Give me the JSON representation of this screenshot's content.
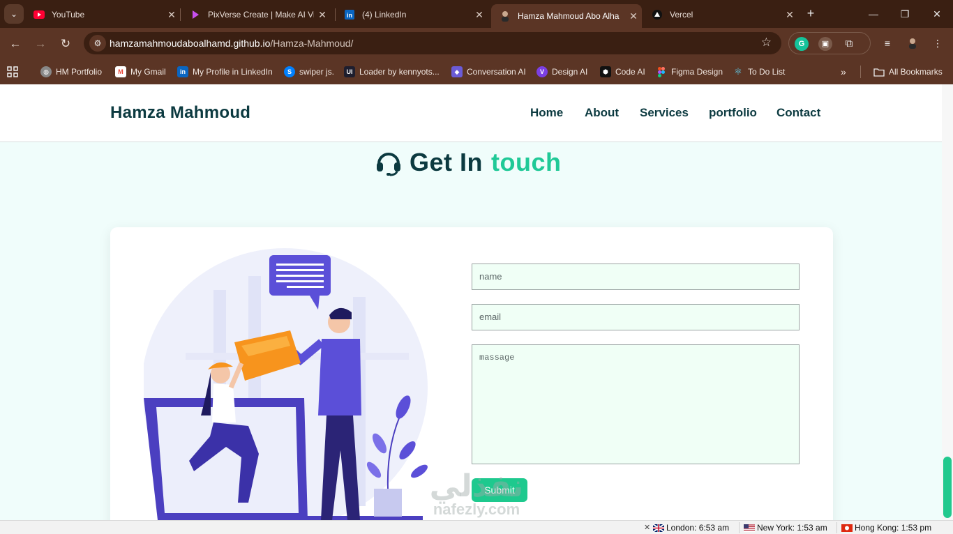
{
  "browser": {
    "tabs": [
      {
        "title": "YouTube",
        "icon": "youtube-icon"
      },
      {
        "title": "PixVerse Create | Make AI Vid",
        "icon": "pixverse-icon"
      },
      {
        "title": "(4) LinkedIn",
        "icon": "linkedin-icon"
      },
      {
        "title": "Hamza Mahmoud Abo Alha",
        "icon": "profile-avatar-icon",
        "active": true
      },
      {
        "title": "Vercel",
        "icon": "vercel-icon"
      }
    ],
    "url_host": "hamzamahmoudaboalhamd.github.io",
    "url_path": "/Hamza-Mahmoud/",
    "bookmarks": [
      {
        "label": "HM Portfolio",
        "icon": "globe-icon"
      },
      {
        "label": "My Gmail",
        "icon": "gmail-icon"
      },
      {
        "label": "My Profile in LinkedIn",
        "icon": "linkedin-icon"
      },
      {
        "label": "swiper js.",
        "icon": "swiper-icon"
      },
      {
        "label": "Loader by kennyots...",
        "icon": "uiverse-icon"
      },
      {
        "label": "Conversation AI",
        "icon": "conversation-ai-icon"
      },
      {
        "label": "Design AI",
        "icon": "design-ai-icon"
      },
      {
        "label": "Code AI",
        "icon": "code-ai-icon"
      },
      {
        "label": "Figma Design",
        "icon": "figma-icon"
      },
      {
        "label": "To Do List",
        "icon": "react-icon"
      }
    ],
    "all_bookmarks": "All Bookmarks"
  },
  "site": {
    "brand": "Hamza Mahmoud",
    "nav": [
      "Home",
      "About",
      "Services",
      "portfolio",
      "Contact"
    ],
    "heading_primary": "Get In",
    "heading_accent": "touch",
    "form": {
      "name_placeholder": "name",
      "email_placeholder": "email",
      "message_placeholder": "massage",
      "submit_label": "Submit"
    },
    "accent_color": "#20c997",
    "brand_color": "#0c3a40"
  },
  "watermark": {
    "arabic": "نفذلي",
    "latin": "nafezly.com"
  },
  "statusbar": {
    "clocks": [
      {
        "city": "London: 6:53 am",
        "flag": "uk-flag-icon"
      },
      {
        "city": "New York: 1:53 am",
        "flag": "us-flag-icon"
      },
      {
        "city": "Hong Kong: 1:53 pm",
        "flag": "hk-flag-icon"
      }
    ]
  }
}
